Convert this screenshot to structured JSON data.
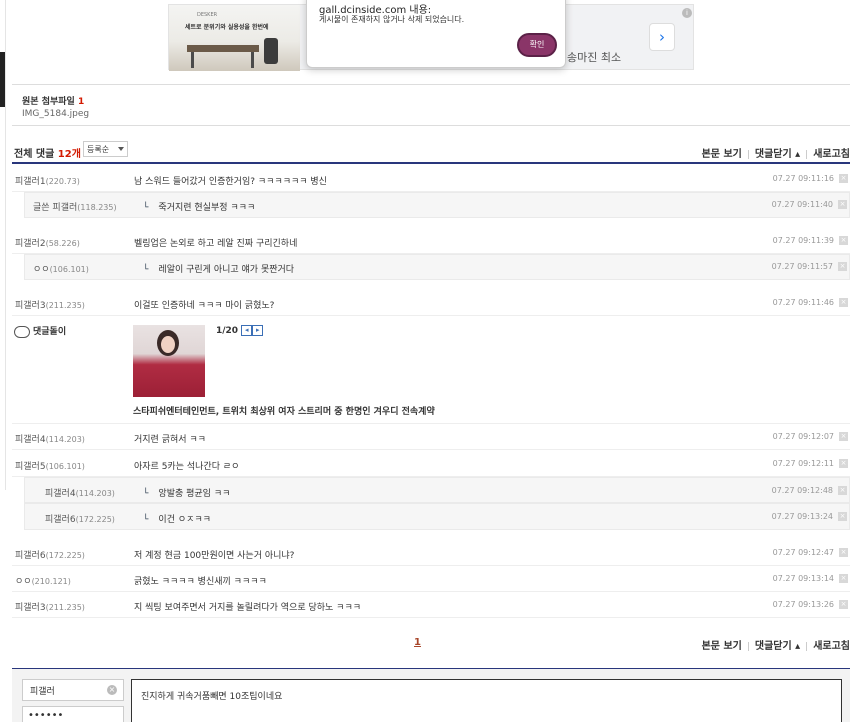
{
  "ad": {
    "image_top_text": "DESKER",
    "image_headline": "세트로 분위기와 실용성을 한번에",
    "text": "송마진 최소",
    "next": "›",
    "info": "i"
  },
  "dialog": {
    "title": "gall.dcinside.com 내용:",
    "message": "게시물이 존재하지 않거나 삭제 되었습니다.",
    "ok": "확인"
  },
  "attachment": {
    "label": "원본 첨부파일",
    "count": "1",
    "filename": "IMG_5184.jpeg"
  },
  "comments_header": {
    "title": "전체 댓글",
    "count": "12개",
    "sort": "등록순",
    "view_post": "본문 보기",
    "close_comments": "댓글닫기 ▴",
    "refresh": "새로고침"
  },
  "comments": [
    {
      "nick": "피갤러1",
      "ip": "(220.73)",
      "text": "남 스워드 들어갔거 인증한거임? ㅋㅋㅋㅋㅋㅋ 병신",
      "date": "07.27 09:11:16"
    },
    {
      "nick": "글쓴 피갤러",
      "ip": "(118.235)",
      "text": "죽거지련 현실부정 ㅋㅋㅋ",
      "date": "07.27 09:11:40"
    },
    {
      "nick": "피갤러2",
      "ip": "(58.226)",
      "text": "벨링업은 논외로 하고 레알 진짜 구리긴하네",
      "date": "07.27 09:11:39"
    },
    {
      "nick": "ㅇㅇ",
      "ip": "(106.101)",
      "text": "레알이 구린게 아니고 얘가 못짠거다",
      "date": "07.27 09:11:57"
    },
    {
      "nick": "피갤러3",
      "ip": "(211.235)",
      "text": "이걸또 인증하네 ㅋㅋㅋ 마이 긁혔노?",
      "date": "07.27 09:11:46"
    },
    {
      "nick": "피갤러4",
      "ip": "(114.203)",
      "text": "거지련 긁혀서 ㅋㅋ",
      "date": "07.27 09:12:07"
    },
    {
      "nick": "피갤러5",
      "ip": "(106.101)",
      "text": "아자르 5카는 석나간다 ㄹㅇ",
      "date": "07.27 09:12:11"
    },
    {
      "nick": "피갤러4",
      "ip": "(114.203)",
      "text": "앙발충 평균임 ㅋㅋ",
      "date": "07.27 09:12:48"
    },
    {
      "nick": "피갤러6",
      "ip": "(172.225)",
      "text": "이건 ㅇㅈㅋㅋ",
      "date": "07.27 09:13:24"
    },
    {
      "nick": "피갤러6",
      "ip": "(172.225)",
      "text": "저 계정 현금 100만원이면 사는거 아니냐?",
      "date": "07.27 09:12:47"
    },
    {
      "nick": "ㅇㅇ",
      "ip": "(210.121)",
      "text": "긁혔노 ㅋㅋㅋㅋ 병신새끼 ㅋㅋㅋㅋ",
      "date": "07.27 09:13:14"
    },
    {
      "nick": "피갤러3",
      "ip": "(211.235)",
      "text": "지 씩팅 보여주면서 거지를 놀릴려다가 역으로 당하노 ㅋㅋㅋ",
      "date": "07.27 09:13:26"
    }
  ],
  "reply_arrow": "└",
  "delete_icon": "×",
  "dccon": {
    "who": "댓글돌이",
    "pager": "1/20",
    "prev": "◂",
    "next": "▸",
    "caption": "스타피쉬엔터테인먼트, 트위치 최상위 여자 스트리머 중 한명인 겨우디 전속계약"
  },
  "pagination": {
    "current": "1"
  },
  "write": {
    "nick": "피갤러",
    "password_mask": "••••••",
    "memo": "진지하게 귀속거품빼면 10조팁이네요"
  }
}
